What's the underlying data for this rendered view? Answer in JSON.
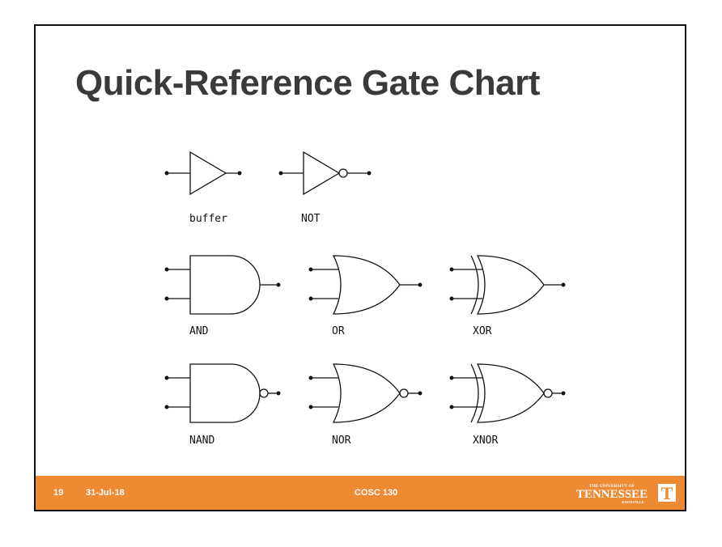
{
  "slide": {
    "title": "Quick-Reference Gate Chart",
    "gates": {
      "buffer": "buffer",
      "not": "NOT",
      "and": "AND",
      "or": "OR",
      "xor": "XOR",
      "nand": "NAND",
      "nor": "NOR",
      "xnor": "XNOR"
    },
    "footer": {
      "page_number": "19",
      "date": "31-Jul-18",
      "course": "COSC 130",
      "logo": {
        "line1": "THE UNIVERSITY OF",
        "line2": "TENNESSEE",
        "line3": "KNOXVILLE",
        "mark": "T"
      },
      "background_color": "#ee8a32"
    }
  }
}
